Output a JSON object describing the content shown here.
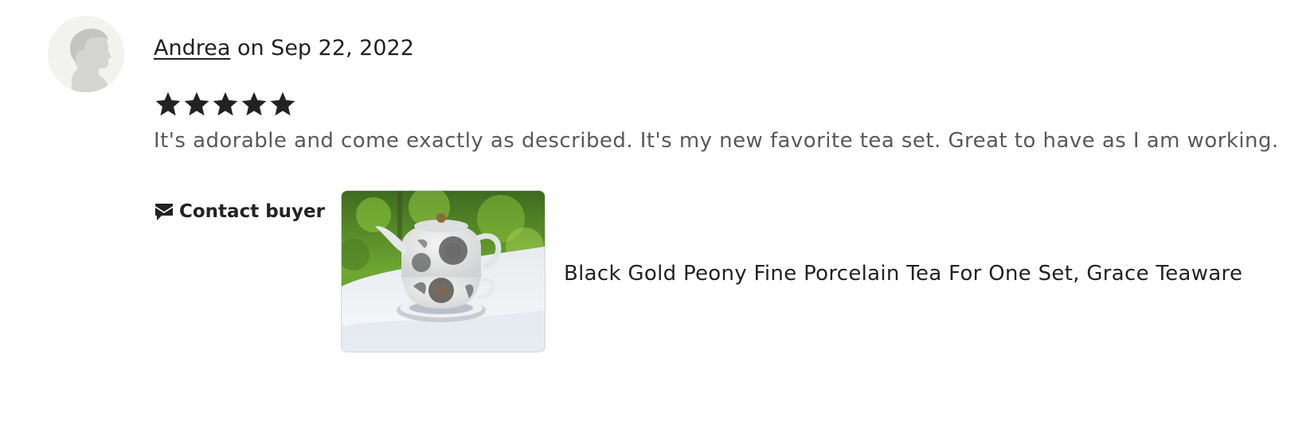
{
  "review": {
    "reviewer_name": "Andrea",
    "date_text": " on Sep 22, 2022",
    "rating": 5,
    "rating_max": 5,
    "text": "It's adorable and come exactly as described. It's my new favorite tea set. Great to have as I am working.",
    "contact_label": "Contact buyer",
    "product_title": "Black Gold Peony Fine Porcelain Tea For One Set, Grace Teaware"
  },
  "icons": {
    "avatar": "default-avatar-icon",
    "star": "star-icon",
    "contact": "message-icon"
  },
  "colors": {
    "text": "#222222",
    "muted_text": "#595959",
    "avatar_bg": "#f2f2ee",
    "avatar_silhouette": "#d4d4d0"
  }
}
